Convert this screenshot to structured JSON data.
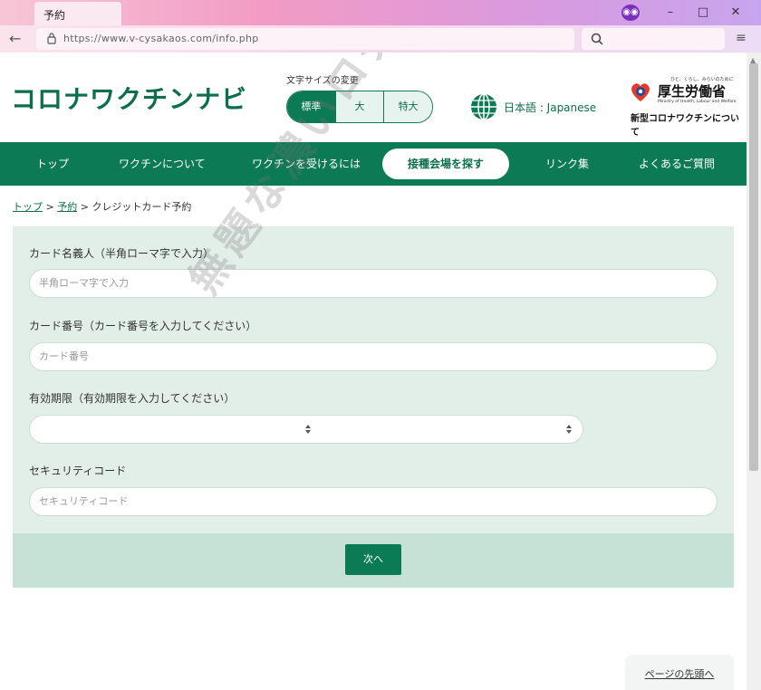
{
  "browser": {
    "tab_title": "予約",
    "url": "https://www.v-cysakaos.com/info.php",
    "minimize": "–",
    "maximize": "□",
    "close": "✕",
    "back_glyph": "←",
    "menu_glyph": "≡",
    "scroll_up_glyph": "▲"
  },
  "site": {
    "logo": "コロナワクチンナビ",
    "font_size_label": "文字サイズの変更",
    "font_size_options": [
      "標準",
      "大",
      "特大"
    ],
    "language": "日本語 : Japanese",
    "mhlw": {
      "tagline": "ひと、くらし、みらいのために",
      "name": "厚生労働省",
      "english": "Ministry of Health, Labour and Welfare",
      "subtitle": "新型コロナワクチンについて"
    }
  },
  "nav": {
    "items": [
      "トップ",
      "ワクチンについて",
      "ワクチンを受けるには",
      "接種会場を探す",
      "リンク集",
      "よくあるご質問"
    ],
    "active_index": 3
  },
  "breadcrumb": {
    "items": [
      "トップ",
      "予約",
      "クレジットカード予約"
    ],
    "separator": ">"
  },
  "form": {
    "fields": [
      {
        "label": "カード名義人（半角ローマ字で入力）",
        "placeholder": "半角ローマ字で入力"
      },
      {
        "label": "カード番号（カード番号を入力してください）",
        "placeholder": "カード番号"
      },
      {
        "label": "有効期限（有効期限を入力してください）",
        "placeholder": ""
      },
      {
        "label": "セキュリティコード",
        "placeholder": "セキュリティコード"
      }
    ],
    "submit_label": "次へ"
  },
  "page_top": "ページの先頭へ",
  "watermark": "無題な濃いログ",
  "colors": {
    "brand_green": "#0d7a56",
    "form_bg": "#e2efe9",
    "submit_bar_bg": "#c6e2d7"
  }
}
